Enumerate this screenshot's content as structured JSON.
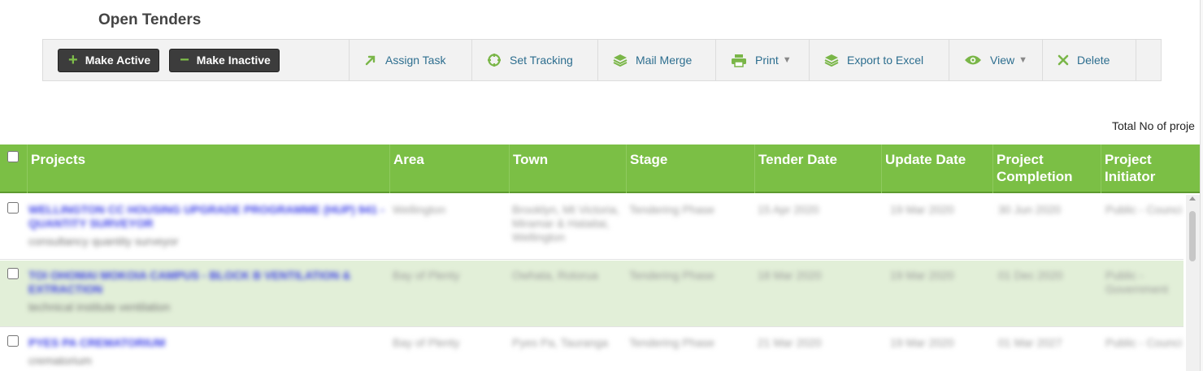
{
  "page": {
    "title": "Open Tenders"
  },
  "toolbar": {
    "make_active": "Make Active",
    "make_inactive": "Make Inactive",
    "assign_task": "Assign Task",
    "set_tracking": "Set Tracking",
    "mail_merge": "Mail Merge",
    "print": "Print",
    "export_excel": "Export to Excel",
    "view": "View",
    "delete": "Delete"
  },
  "summary": {
    "total_label": "Total No of proje"
  },
  "table": {
    "headers": {
      "projects": "Projects",
      "area": "Area",
      "town": "Town",
      "stage": "Stage",
      "tender_date": "Tender Date",
      "update_date": "Update Date",
      "project_completion": "Project Completion",
      "project_initiator": "Project Initiator"
    },
    "rows": [
      {
        "project": "WELLINGTON CC HOUSING UPGRADE PROGRAMME (HUP) 941 - QUANTITY SURVEYOR",
        "sub": "consultancy quantity surveyor",
        "area": "Wellington",
        "town": "Brooklyn, Mt Victoria, Miramar & Hataitai, Wellington",
        "stage": "Tendering Phase",
        "tender_date": "15 Apr 2020",
        "update_date": "19 Mar 2020",
        "completion": "30 Jun 2020",
        "initiator": "Public - Council"
      },
      {
        "project": "TOI OHOMAI MOKOIA CAMPUS - BLOCK B VENTILATION & EXTRACTION",
        "sub": "technical institute ventilation",
        "area": "Bay of Plenty",
        "town": "Owhata, Rotorua",
        "stage": "Tendering Phase",
        "tender_date": "18 Mar 2020",
        "update_date": "19 Mar 2020",
        "completion": "01 Dec 2020",
        "initiator": "Public - Government"
      },
      {
        "project": "PYES PA CREMATORIUM",
        "sub": "crematorium",
        "area": "Bay of Plenty",
        "town": "Pyes Pa, Tauranga",
        "stage": "Tendering Phase",
        "tender_date": "21 Mar 2020",
        "update_date": "19 Mar 2020",
        "completion": "01 Mar 2027",
        "initiator": "Public - Council"
      }
    ]
  },
  "colors": {
    "header_green": "#7bbf45",
    "alt_row": "#e2efd8",
    "link_blue": "#2d6e8f",
    "icon_green": "#7ab648"
  }
}
